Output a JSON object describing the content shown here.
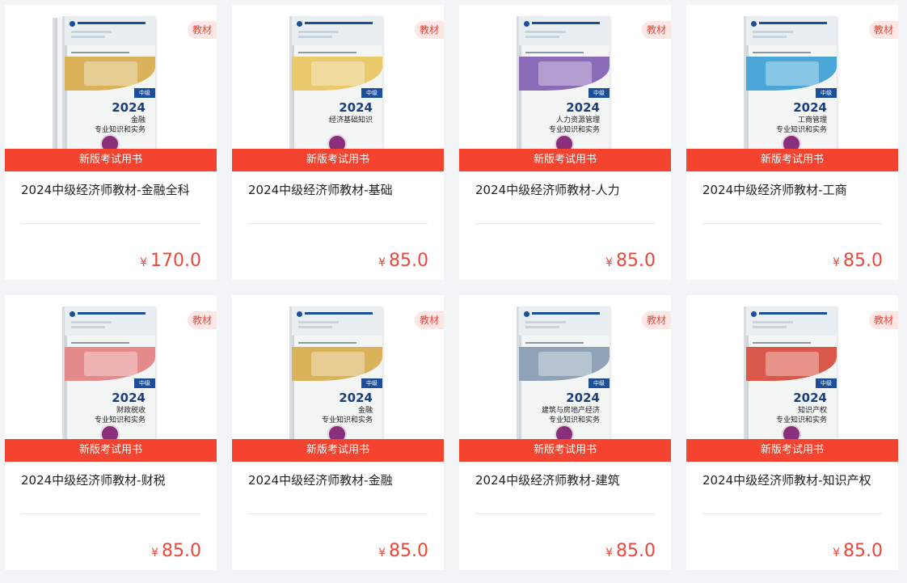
{
  "products": [
    {
      "title": "2024中级经济师教材-金融全科",
      "banner": "新版考试用书",
      "tag": "教材",
      "currency": "¥",
      "price": "170.0",
      "cover": {
        "year": "2024",
        "subject": "金融\n专业知识和实务",
        "grade": "中级",
        "band_color": "#d9b25a"
      }
    },
    {
      "title": "2024中级经济师教材-基础",
      "banner": "新版考试用书",
      "tag": "教材",
      "currency": "¥",
      "price": "85.0",
      "cover": {
        "year": "2024",
        "subject": "经济基础知识",
        "grade": "中级",
        "band_color": "#e9c96a"
      }
    },
    {
      "title": "2024中级经济师教材-人力",
      "banner": "新版考试用书",
      "tag": "教材",
      "currency": "¥",
      "price": "85.0",
      "cover": {
        "year": "2024",
        "subject": "人力资源管理\n专业知识和实务",
        "grade": "中级",
        "band_color": "#8a6bb8"
      }
    },
    {
      "title": "2024中级经济师教材-工商",
      "banner": "新版考试用书",
      "tag": "教材",
      "currency": "¥",
      "price": "85.0",
      "cover": {
        "year": "2024",
        "subject": "工商管理\n专业知识和实务",
        "grade": "中级",
        "band_color": "#4aa6d6"
      }
    },
    {
      "title": "2024中级经济师教材-财税",
      "banner": "新版考试用书",
      "tag": "教材",
      "currency": "¥",
      "price": "85.0",
      "cover": {
        "year": "2024",
        "subject": "财政税收\n专业知识和实务",
        "grade": "中级",
        "band_color": "#e58a8a"
      }
    },
    {
      "title": "2024中级经济师教材-金融",
      "banner": "新版考试用书",
      "tag": "教材",
      "currency": "¥",
      "price": "85.0",
      "cover": {
        "year": "2024",
        "subject": "金融\n专业知识和实务",
        "grade": "中级",
        "band_color": "#d9b25a"
      }
    },
    {
      "title": "2024中级经济师教材-建筑",
      "banner": "新版考试用书",
      "tag": "教材",
      "currency": "¥",
      "price": "85.0",
      "cover": {
        "year": "2024",
        "subject": "建筑与房地产经济\n专业知识和实务",
        "grade": "中级",
        "band_color": "#8fa3b8"
      }
    },
    {
      "title": "2024中级经济师教材-知识产权",
      "banner": "新版考试用书",
      "tag": "教材",
      "currency": "¥",
      "price": "85.0",
      "cover": {
        "year": "2024",
        "subject": "知识产权\n专业知识和实务",
        "grade": "中级",
        "band_color": "#d9584a"
      }
    }
  ]
}
